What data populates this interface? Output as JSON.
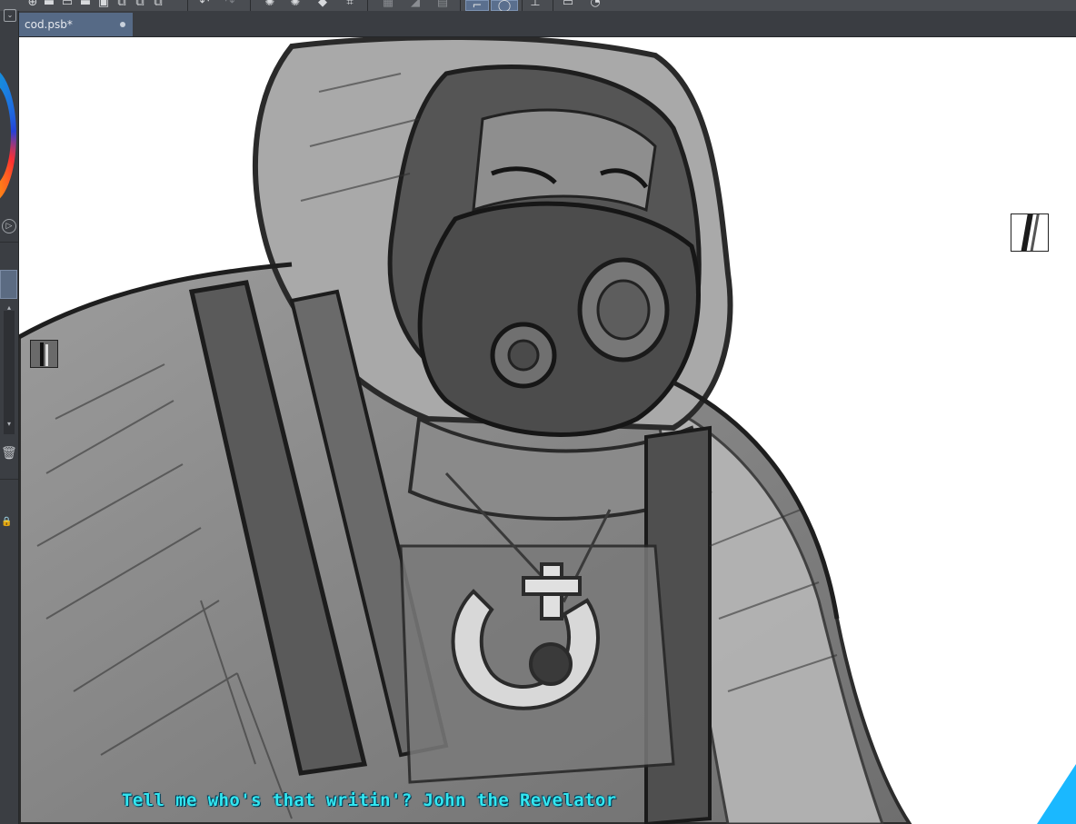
{
  "document_tab": {
    "title": "cod.psb*"
  },
  "caption": {
    "text": "Tell me who's that writin'? John the Revelator"
  },
  "colors": {
    "toolbar_bg": "#4a4d52",
    "panel_bg": "#3b3e43",
    "tab_active": "#566a86",
    "canvas_bg": "#ffffff",
    "caption_text": "#33e6f0"
  },
  "toolbar_icons": [
    "new-file-icon",
    "open-file-icon",
    "save-icon",
    "copy-icon",
    "paste-icon",
    "undo-icon",
    "redo-icon",
    "clear-icon",
    "fill-icon",
    "transform-icon",
    "select-rect-icon",
    "select-lasso-icon",
    "ruler-icon",
    "window-icon",
    "share-icon"
  ]
}
